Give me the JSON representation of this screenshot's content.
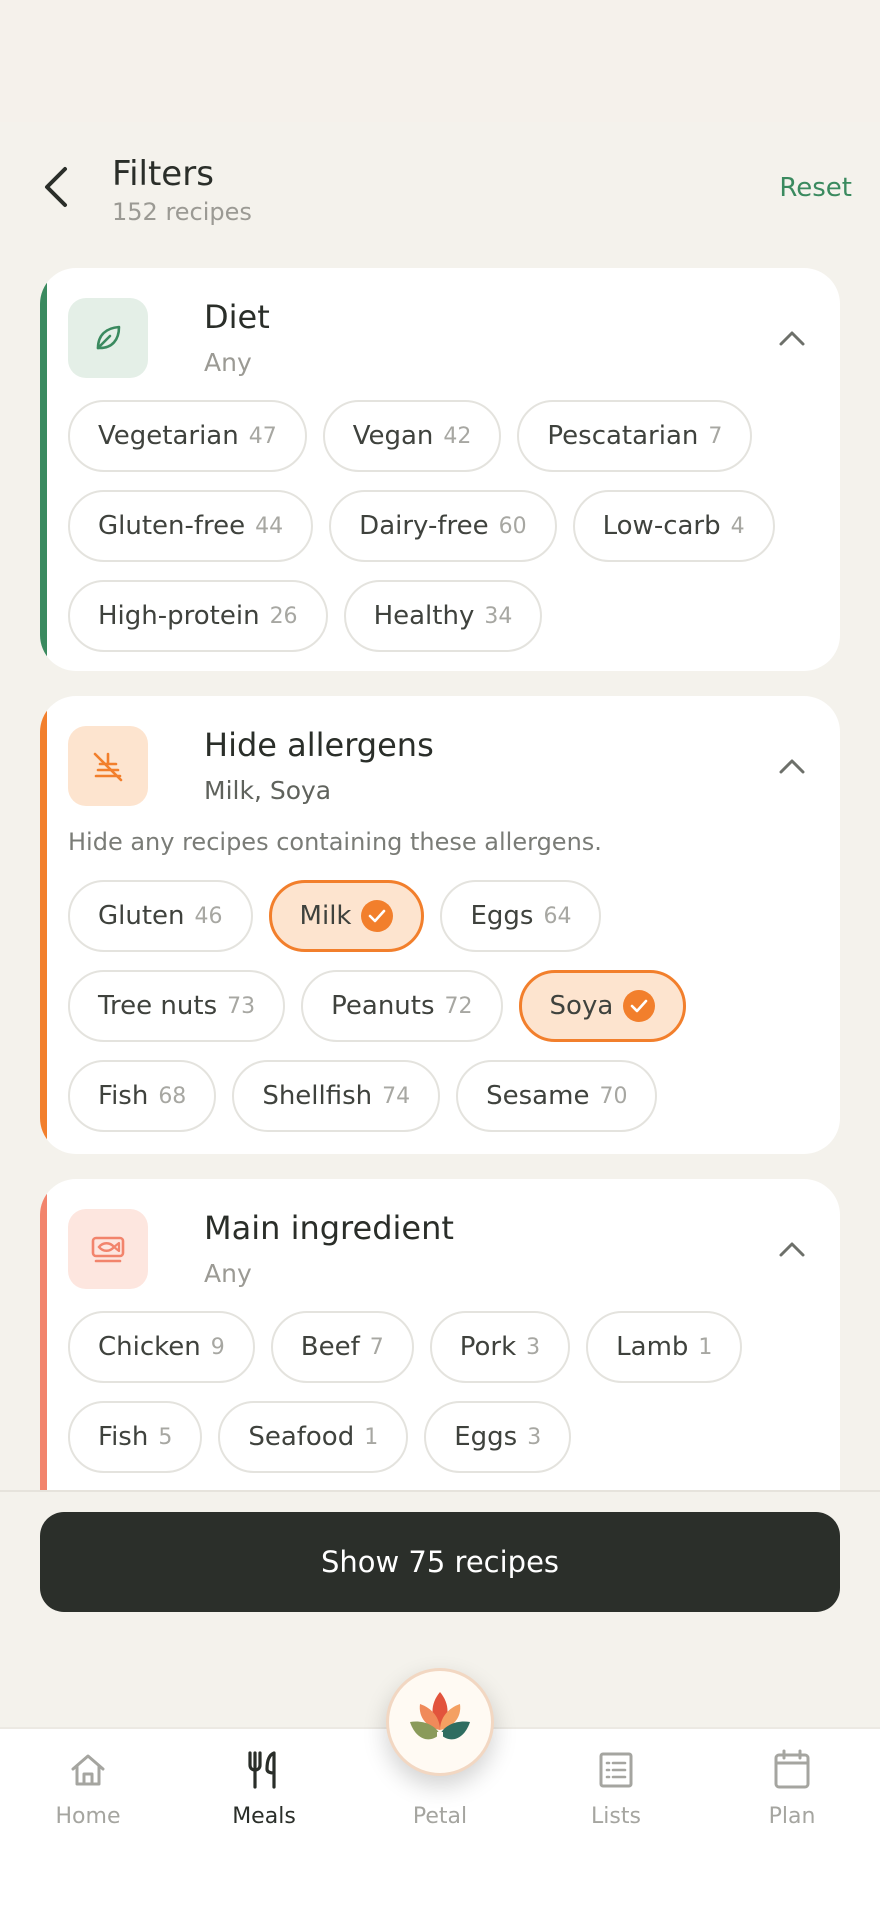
{
  "header": {
    "title": "Filters",
    "subtitle": "152 recipes",
    "reset_label": "Reset"
  },
  "diet": {
    "title": "Diet",
    "subtitle": "Any",
    "accent": "#3a8a5f",
    "chips": [
      {
        "label": "Vegetarian",
        "count": "47"
      },
      {
        "label": "Vegan",
        "count": "42"
      },
      {
        "label": "Pescatarian",
        "count": "7"
      },
      {
        "label": "Gluten-free",
        "count": "44"
      },
      {
        "label": "Dairy-free",
        "count": "60"
      },
      {
        "label": "Low-carb",
        "count": "4"
      },
      {
        "label": "High-protein",
        "count": "26"
      },
      {
        "label": "Healthy",
        "count": "34"
      }
    ]
  },
  "allergens": {
    "title": "Hide allergens",
    "subtitle": "Milk, Soya",
    "description": "Hide any recipes containing these allergens.",
    "accent": "#f27f2c",
    "chips": [
      {
        "label": "Gluten",
        "count": "46"
      },
      {
        "label": "Milk",
        "selected": true
      },
      {
        "label": "Eggs",
        "count": "64"
      },
      {
        "label": "Tree nuts",
        "count": "73"
      },
      {
        "label": "Peanuts",
        "count": "72"
      },
      {
        "label": "Soya",
        "selected": true
      },
      {
        "label": "Fish",
        "count": "68"
      },
      {
        "label": "Shellfish",
        "count": "74"
      },
      {
        "label": "Sesame",
        "count": "70"
      }
    ]
  },
  "ingredient": {
    "title": "Main ingredient",
    "subtitle": "Any",
    "accent": "#f2846c",
    "chips": [
      {
        "label": "Chicken",
        "count": "9"
      },
      {
        "label": "Beef",
        "count": "7"
      },
      {
        "label": "Pork",
        "count": "3"
      },
      {
        "label": "Lamb",
        "count": "1"
      },
      {
        "label": "Fish",
        "count": "5"
      },
      {
        "label": "Seafood",
        "count": "1"
      },
      {
        "label": "Eggs",
        "count": "3"
      }
    ]
  },
  "cta_label": "Show 75 recipes",
  "tabs": {
    "home": "Home",
    "meals": "Meals",
    "petal": "Petal",
    "lists": "Lists",
    "plan": "Plan",
    "active": "meals"
  }
}
